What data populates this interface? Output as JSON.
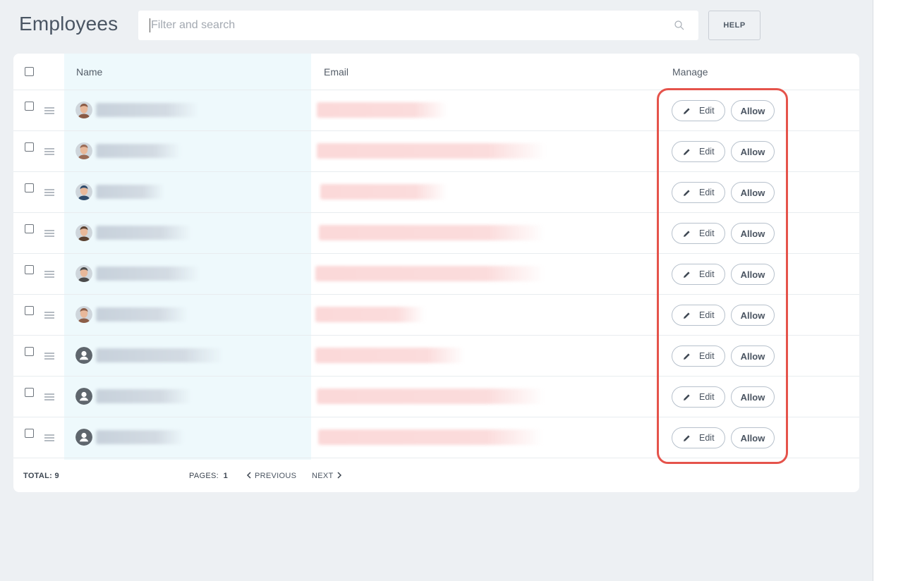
{
  "page_title": "Employees",
  "search": {
    "placeholder": "Filter and search"
  },
  "help_label": "HELP",
  "table": {
    "columns": {
      "name": "Name",
      "email": "Email",
      "manage": "Manage"
    },
    "edit_label": "Edit",
    "allow_label": "Allow",
    "rows": [
      {
        "avatar": "photo",
        "avatar_color": "#8a5a44"
      },
      {
        "avatar": "photo",
        "avatar_color": "#9a6b56"
      },
      {
        "avatar": "photo",
        "avatar_color": "#2e4a6b"
      },
      {
        "avatar": "photo",
        "avatar_color": "#5a4030"
      },
      {
        "avatar": "photo",
        "avatar_color": "#4b4b4b"
      },
      {
        "avatar": "photo",
        "avatar_color": "#8c5e48"
      },
      {
        "avatar": "user-icon",
        "avatar_color": "#5f666d"
      },
      {
        "avatar": "user-icon",
        "avatar_color": "#5f666d"
      },
      {
        "avatar": "user-icon",
        "avatar_color": "#5f666d"
      }
    ]
  },
  "footer": {
    "total_label": "TOTAL:",
    "total_value": "9",
    "pages_label": "PAGES:",
    "pages_value": "1",
    "previous_label": "PREVIOUS",
    "next_label": "NEXT"
  },
  "colors": {
    "highlight": "#e5534b",
    "name_column_bg": "#eef9fc",
    "background": "#edf0f3"
  }
}
